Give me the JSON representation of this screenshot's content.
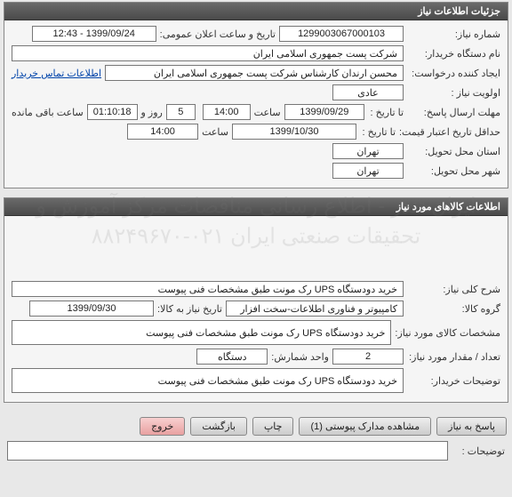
{
  "panel1": {
    "title": "جزئیات اطلاعات نیاز",
    "labels": {
      "reqNo": "شماره نیاز:",
      "publicDate": "تاریخ و ساعت اعلان عمومی:",
      "buyerOrg": "نام دستگاه خریدار:",
      "creator": "ایجاد کننده درخواست:",
      "contactLink": "اطلاعات تماس خریدار",
      "priority": "اولویت نیاز :",
      "replyDeadline": "مهلت ارسال پاسخ:",
      "toDate": "تا تاریخ :",
      "hour": "ساعت",
      "days": "روز و",
      "timeLeft": "ساعت باقی مانده",
      "validMin": "حداقل تاریخ اعتبار قیمت:",
      "deliverProv": "استان محل تحویل:",
      "deliverCity": "شهر محل تحویل:"
    },
    "values": {
      "reqNo": "1299003067000103",
      "publicDate": "1399/09/24 - 12:43",
      "buyerOrg": "شرکت پست جمهوری اسلامی ایران",
      "creator": "محسن ارندان کارشناس شرکت پست جمهوری اسلامی ایران",
      "priority": "عادی",
      "replyDate": "1399/09/29",
      "replyHour": "14:00",
      "daysLeft": "5",
      "timeLeft": "01:10:18",
      "validDate": "1399/10/30",
      "validHour": "14:00",
      "province": "تهران",
      "city": "تهران"
    }
  },
  "panel2": {
    "title": "اطلاعات کالاهای مورد نیاز",
    "labels": {
      "generalDesc": "شرح کلی نیاز:",
      "goodsGroup": "گروه کالا:",
      "needByDate": "تاریخ نیاز به کالا:",
      "goodsSpec": "مشخصات کالای مورد نیاز:",
      "qty": "تعداد / مقدار مورد نیاز:",
      "unit": "واحد شمارش:",
      "buyerNotes": "توضیحات خریدار:"
    },
    "values": {
      "generalDesc": "خرید دودستگاه UPS رک مونت طبق مشخصات فنی پیوست",
      "goodsGroup": "کامپیوتر و فناوری اطلاعات-سخت افزار",
      "needByDate": "1399/09/30",
      "goodsSpec": "خرید دودستگاه UPS رک مونت طبق مشخصات فنی پیوست",
      "qty": "2",
      "unit": "دستگاه",
      "buyerNotes": "خرید دودستگاه UPS رک مونت طبق مشخصات فنی پیوست"
    }
  },
  "buttons": {
    "reply": "پاسخ به نیاز",
    "attachments": "مشاهده مدارک پیوستی (1)",
    "print": "چاپ",
    "back": "بازگشت",
    "exit": "خروج"
  },
  "notes": {
    "label": "توضیحات :"
  },
  "watermark": "ایران تندر - اطلاع رسانی مناقصات\nمرکز آموزش و تحقیقات صنعتی ایران\n۰۲۱-۸۸۲۴۹۶۷۰"
}
